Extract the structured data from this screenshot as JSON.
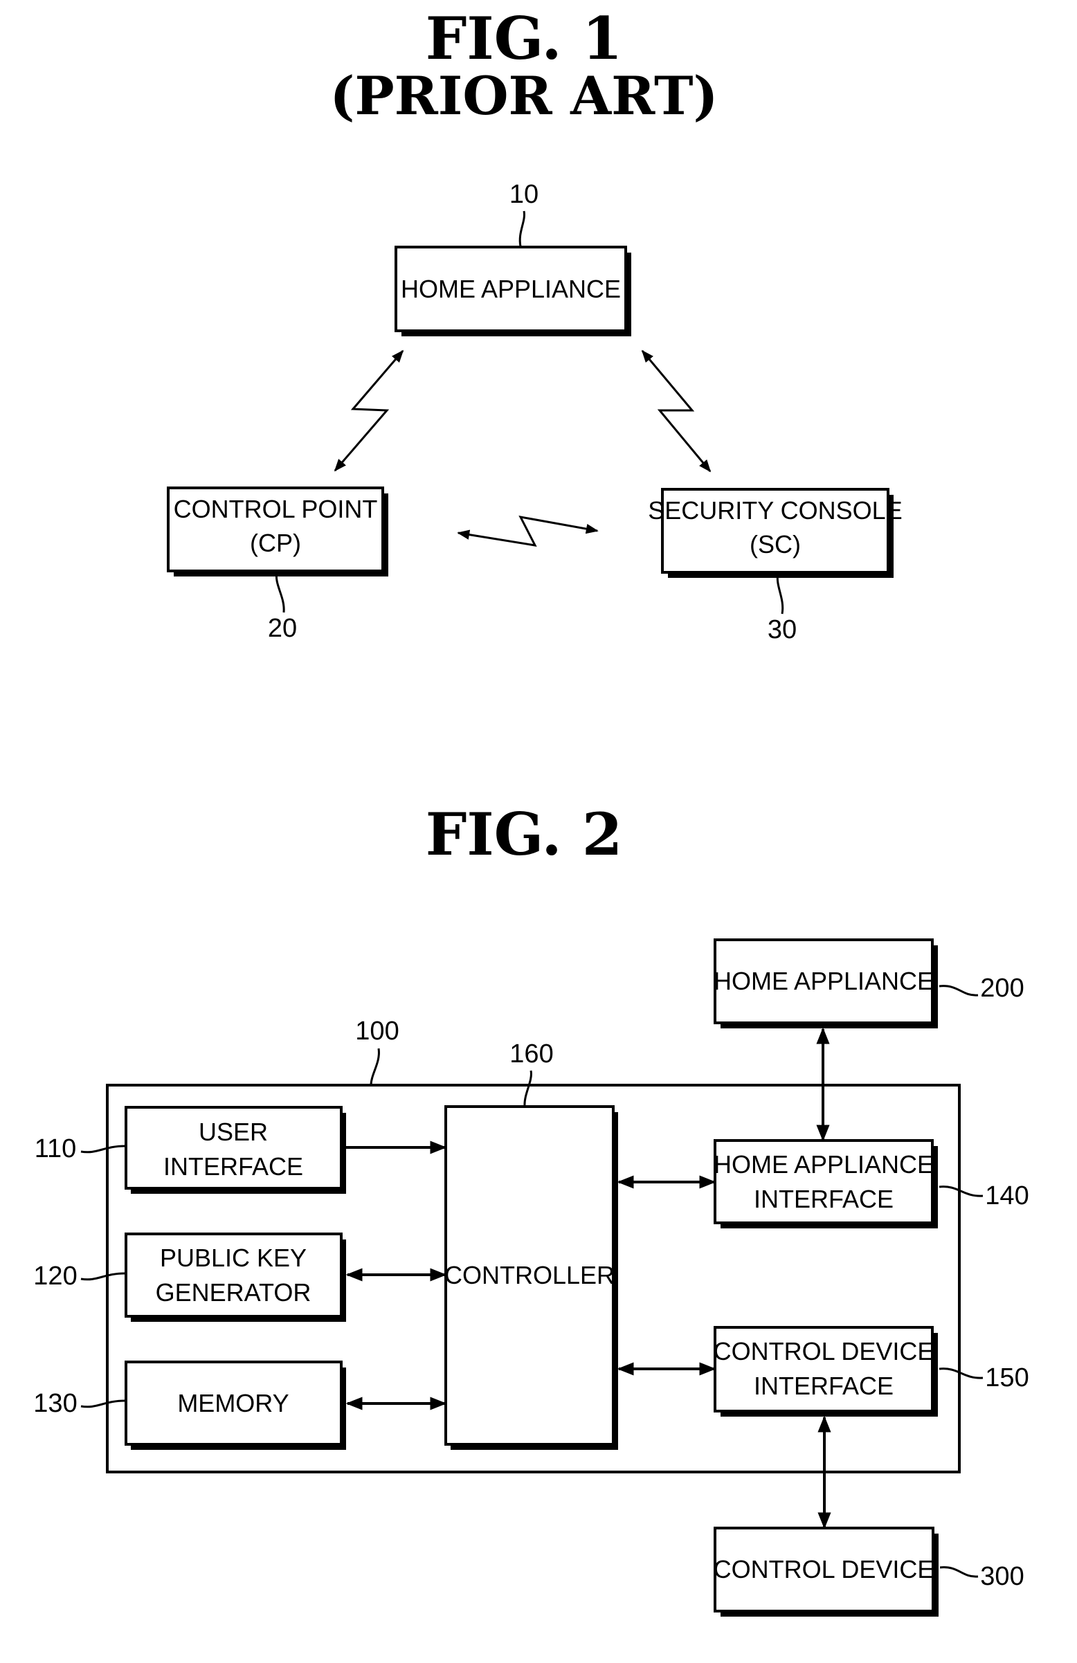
{
  "fig1": {
    "title": "FIG.  1",
    "subtitle": "(PRIOR ART)",
    "blocks": [
      {
        "id": "home-appliance",
        "ref": "10",
        "lines": [
          "HOME APPLIANCE"
        ]
      },
      {
        "id": "control-point",
        "ref": "20",
        "lines": [
          "CONTROL POINT",
          "(CP)"
        ]
      },
      {
        "id": "security-console",
        "ref": "30",
        "lines": [
          "SECURITY CONSOLE",
          "(SC)"
        ]
      }
    ],
    "links": [
      {
        "from": "home-appliance",
        "to": "control-point",
        "type": "wireless-bidirectional"
      },
      {
        "from": "home-appliance",
        "to": "security-console",
        "type": "wireless-bidirectional"
      },
      {
        "from": "control-point",
        "to": "security-console",
        "type": "wireless-bidirectional"
      }
    ]
  },
  "fig2": {
    "title": "FIG.  2",
    "system_ref": "100",
    "blocks": [
      {
        "id": "user-interface",
        "ref": "110",
        "lines": [
          "USER",
          "INTERFACE"
        ]
      },
      {
        "id": "public-key-generator",
        "ref": "120",
        "lines": [
          "PUBLIC KEY",
          "GENERATOR"
        ]
      },
      {
        "id": "memory",
        "ref": "130",
        "lines": [
          "MEMORY"
        ]
      },
      {
        "id": "controller",
        "ref": "160",
        "lines": [
          "CONTROLLER"
        ]
      },
      {
        "id": "home-appliance-interface",
        "ref": "140",
        "lines": [
          "HOME APPLIANCE",
          "INTERFACE"
        ]
      },
      {
        "id": "control-device-interface",
        "ref": "150",
        "lines": [
          "CONTROL DEVICE",
          "INTERFACE"
        ]
      },
      {
        "id": "home-appliance",
        "ref": "200",
        "lines": [
          "HOME APPLIANCE"
        ]
      },
      {
        "id": "control-device",
        "ref": "300",
        "lines": [
          "CONTROL DEVICE"
        ]
      }
    ],
    "links": [
      {
        "from": "user-interface",
        "to": "controller",
        "type": "unidirectional"
      },
      {
        "from": "public-key-generator",
        "to": "controller",
        "type": "bidirectional"
      },
      {
        "from": "memory",
        "to": "controller",
        "type": "bidirectional"
      },
      {
        "from": "controller",
        "to": "home-appliance-interface",
        "type": "bidirectional"
      },
      {
        "from": "controller",
        "to": "control-device-interface",
        "type": "bidirectional"
      },
      {
        "from": "home-appliance-interface",
        "to": "home-appliance",
        "type": "bidirectional"
      },
      {
        "from": "control-device-interface",
        "to": "control-device",
        "type": "bidirectional"
      }
    ]
  }
}
